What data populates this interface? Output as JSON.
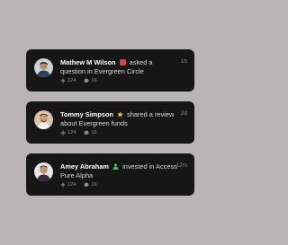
{
  "colors": {
    "background": "#b9b5b5",
    "card": "#161616",
    "text": "#ffffff",
    "muted": "#8c8c8c"
  },
  "feed": [
    {
      "name": "Mathew M Wilson",
      "emoji": "red-badge-icon",
      "action_text": "asked a question in Evergreen Circle",
      "time": "1h",
      "likes": "124",
      "comments": "16"
    },
    {
      "name": "Tommy Simpson",
      "emoji": "star-icon",
      "action_text": "shared a review about Evergreen funds",
      "time": "2d",
      "likes": "124",
      "comments": "16"
    },
    {
      "name": "Amey Abraham",
      "emoji": "green-person-icon",
      "action_text": "invested in Access Pure Alpha",
      "time": "12m",
      "likes": "124",
      "comments": "16"
    }
  ]
}
